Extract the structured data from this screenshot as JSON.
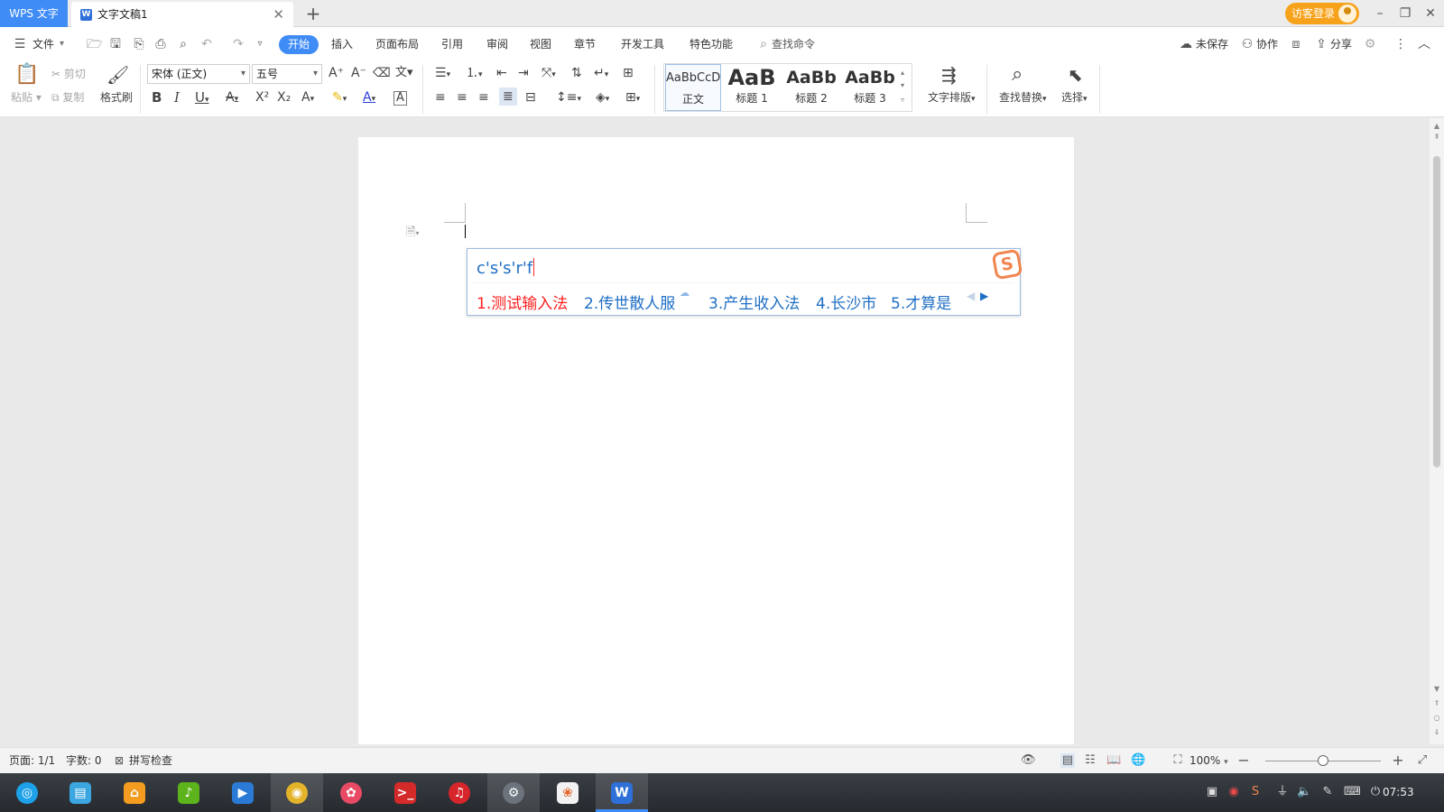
{
  "titlebar": {
    "app_tab": "WPS 文字",
    "doc_tab": "文字文稿1",
    "login": "访客登录"
  },
  "menubar": {
    "file": "文件",
    "tabs": [
      "开始",
      "插入",
      "页面布局",
      "引用",
      "审阅",
      "视图",
      "章节",
      "开发工具",
      "特色功能"
    ],
    "search": "查找命令",
    "unsaved": "未保存",
    "collab": "协作",
    "share": "分享"
  },
  "ribbon": {
    "paste": "粘贴",
    "cut": "剪切",
    "copy": "复制",
    "format_painter": "格式刷",
    "font_name": "宋体 (正文)",
    "font_size": "五号",
    "styles": [
      {
        "sample": "AaBbCcD",
        "label": "正文"
      },
      {
        "sample": "AaB",
        "label": "标题 1"
      },
      {
        "sample": "AaBb",
        "label": "标题 2"
      },
      {
        "sample": "AaBb",
        "label": "标题 3"
      }
    ],
    "text_layout": "文字排版",
    "find_replace": "查找替换",
    "select": "选择"
  },
  "ime": {
    "composition": "c's's'r'f",
    "candidates": [
      "1.测试输入法",
      "2.传世散人服",
      "3.产生收入法",
      "4.长沙市",
      "5.才算是"
    ]
  },
  "statusbar": {
    "page": "页面: 1/1",
    "words": "字数: 0",
    "spell_check": "拼写检查",
    "zoom": "100%",
    "zoom_level": 0.5
  },
  "taskbar": {
    "time": "07:53"
  },
  "colors": {
    "accent": "#3f8cf7",
    "login": "#f7a21b",
    "ime_text": "#1f6fc5",
    "ime_first": "#ff1e1e"
  }
}
